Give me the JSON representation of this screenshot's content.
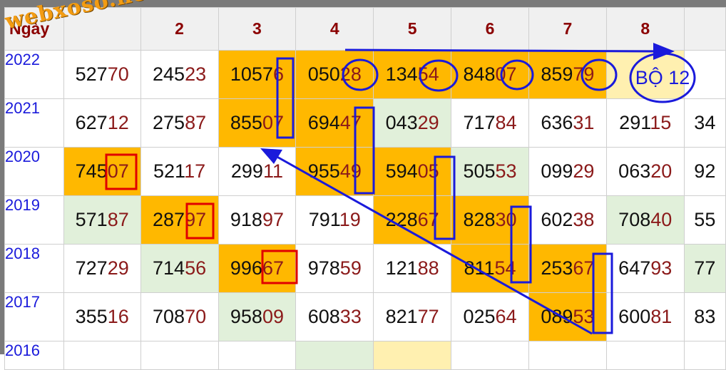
{
  "watermark": "webxoso.net",
  "header": {
    "first": "Ngày",
    "cols": [
      "",
      "2",
      "3",
      "4",
      "5",
      "6",
      "7",
      "8",
      ""
    ]
  },
  "rows": [
    {
      "year": "2022",
      "cells": [
        {
          "a": "527",
          "b": "70",
          "bg": "w"
        },
        {
          "a": "245",
          "b": "23",
          "bg": "w"
        },
        {
          "a": "1057",
          "b": "6",
          "bg": "o"
        },
        {
          "a": "050",
          "b": "28",
          "bg": "o"
        },
        {
          "a": "134",
          "b": "54",
          "bg": "o"
        },
        {
          "a": "848",
          "b": "07",
          "bg": "o"
        },
        {
          "a": "859",
          "b": "79",
          "bg": "o"
        },
        {
          "a": "",
          "b": "",
          "bg": "p"
        },
        {
          "a": "",
          "b": "",
          "bg": "w"
        }
      ]
    },
    {
      "year": "2021",
      "cells": [
        {
          "a": "627",
          "b": "12",
          "bg": "w"
        },
        {
          "a": "275",
          "b": "87",
          "bg": "w"
        },
        {
          "a": "855",
          "b": "07",
          "bg": "o"
        },
        {
          "a": "694",
          "b": "47",
          "bg": "o"
        },
        {
          "a": "043",
          "b": "29",
          "bg": "g"
        },
        {
          "a": "717",
          "b": "84",
          "bg": "w"
        },
        {
          "a": "636",
          "b": "31",
          "bg": "w"
        },
        {
          "a": "291",
          "b": "15",
          "bg": "w"
        },
        {
          "a": "34",
          "b": "",
          "bg": "w"
        }
      ]
    },
    {
      "year": "2020",
      "cells": [
        {
          "a": "745",
          "b": "07",
          "bg": "o"
        },
        {
          "a": "521",
          "b": "17",
          "bg": "w"
        },
        {
          "a": "299",
          "b": "11",
          "bg": "w"
        },
        {
          "a": "955",
          "b": "49",
          "bg": "o"
        },
        {
          "a": "594",
          "b": "05",
          "bg": "o"
        },
        {
          "a": "505",
          "b": "53",
          "bg": "g"
        },
        {
          "a": "099",
          "b": "29",
          "bg": "w"
        },
        {
          "a": "063",
          "b": "20",
          "bg": "w"
        },
        {
          "a": "92",
          "b": "",
          "bg": "w"
        }
      ]
    },
    {
      "year": "2019",
      "cells": [
        {
          "a": "571",
          "b": "87",
          "bg": "g"
        },
        {
          "a": "287",
          "b": "97",
          "bg": "o"
        },
        {
          "a": "918",
          "b": "97",
          "bg": "w"
        },
        {
          "a": "791",
          "b": "19",
          "bg": "w"
        },
        {
          "a": "228",
          "b": "67",
          "bg": "o"
        },
        {
          "a": "828",
          "b": "30",
          "bg": "o"
        },
        {
          "a": "602",
          "b": "38",
          "bg": "w"
        },
        {
          "a": "708",
          "b": "40",
          "bg": "g"
        },
        {
          "a": "55",
          "b": "",
          "bg": "w"
        }
      ]
    },
    {
      "year": "2018",
      "cells": [
        {
          "a": "727",
          "b": "29",
          "bg": "w"
        },
        {
          "a": "714",
          "b": "56",
          "bg": "g"
        },
        {
          "a": "996",
          "b": "67",
          "bg": "o"
        },
        {
          "a": "978",
          "b": "59",
          "bg": "w"
        },
        {
          "a": "121",
          "b": "88",
          "bg": "w"
        },
        {
          "a": "811",
          "b": "54",
          "bg": "o"
        },
        {
          "a": "253",
          "b": "67",
          "bg": "o"
        },
        {
          "a": "647",
          "b": "93",
          "bg": "w"
        },
        {
          "a": "77",
          "b": "",
          "bg": "g"
        }
      ]
    },
    {
      "year": "2017",
      "cells": [
        {
          "a": "355",
          "b": "16",
          "bg": "w"
        },
        {
          "a": "708",
          "b": "70",
          "bg": "w"
        },
        {
          "a": "958",
          "b": "09",
          "bg": "g"
        },
        {
          "a": "608",
          "b": "33",
          "bg": "w"
        },
        {
          "a": "821",
          "b": "77",
          "bg": "w"
        },
        {
          "a": "025",
          "b": "64",
          "bg": "w"
        },
        {
          "a": "089",
          "b": "53",
          "bg": "o"
        },
        {
          "a": "600",
          "b": "81",
          "bg": "w"
        },
        {
          "a": "83",
          "b": "",
          "bg": "w"
        }
      ]
    },
    {
      "year": "2016",
      "cells": [
        {
          "a": "",
          "b": "",
          "bg": "w"
        },
        {
          "a": "",
          "b": "",
          "bg": "w"
        },
        {
          "a": "",
          "b": "",
          "bg": "w"
        },
        {
          "a": "",
          "b": "",
          "bg": "g"
        },
        {
          "a": "",
          "b": "",
          "bg": "p"
        },
        {
          "a": "",
          "b": "",
          "bg": "w"
        },
        {
          "a": "",
          "b": "",
          "bg": "w"
        },
        {
          "a": "",
          "b": "",
          "bg": "w"
        },
        {
          "a": "",
          "b": "",
          "bg": "w"
        }
      ]
    }
  ],
  "annotation": "BỘ 12",
  "colors": {
    "orange": "#ffb800",
    "green": "#e1f0da",
    "blue": "#1a1adb",
    "red": "#e00000",
    "darkred": "#8b1a1a"
  }
}
